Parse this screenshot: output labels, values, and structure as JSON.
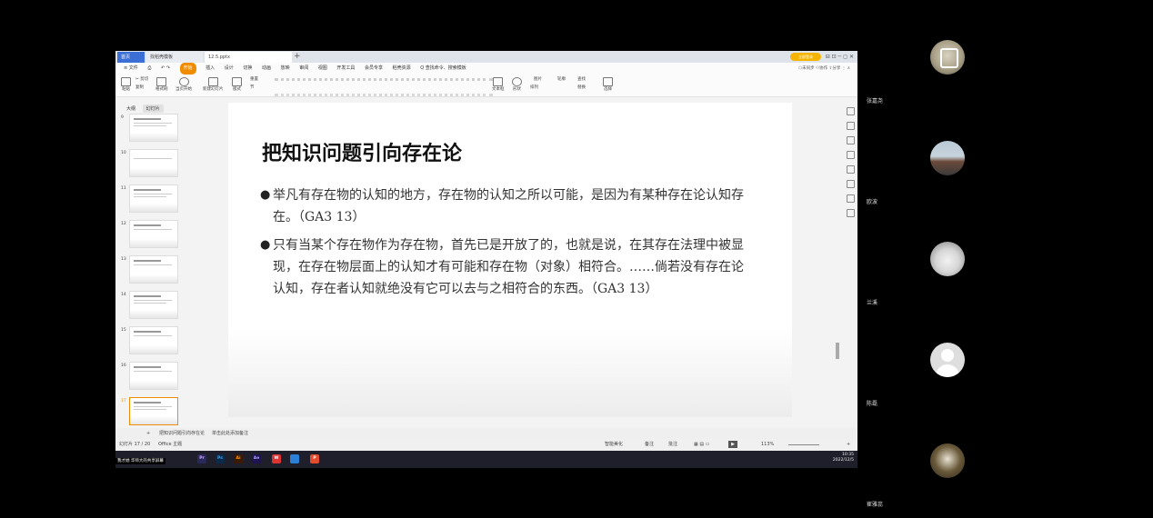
{
  "window": {
    "tabs": [
      "首页",
      "找稻壳模板",
      "12.5.pptx"
    ],
    "login_label": "立即登录",
    "controls": "⊟ ⊡  ─  ◻  ✕"
  },
  "menu": {
    "items": [
      "≡ 文件",
      "⎙",
      "↶ ↷",
      "开始",
      "插入",
      "设计",
      "切换",
      "动画",
      "放映",
      "审阅",
      "视图",
      "开发工具",
      "会员专享",
      "稻壳资源",
      "Q 查找命令、搜索模板"
    ],
    "active": "开始",
    "right": "⬡未同步  ⚇协作  ⇪分享  ⋮  ∧"
  },
  "ribbon": {
    "buttons": [
      "粘贴",
      "✂ 剪切",
      "复制",
      "格式刷",
      "当页开始",
      "新建幻灯片",
      "版式",
      "重置",
      "节",
      "文本框",
      "形状",
      "排列",
      "图片",
      "轮廓",
      "查找",
      "替换",
      "选择"
    ]
  },
  "sidebar": {
    "tabs": [
      "大纲",
      "幻灯片"
    ],
    "slides": [
      "9",
      "10",
      "11",
      "12",
      "13",
      "14",
      "15",
      "16",
      "17"
    ]
  },
  "slide": {
    "title": "把知识问题引向存在论",
    "bullets": [
      "举凡有存在物的认知的地方，存在物的认知之所以可能，是因为有某种存在论认知存在。（GA3 13）",
      "只有当某个存在物作为存在物，首先已是开放了的，也就是说，在其存在法理中被显现，在存在物层面上的认知才有可能和存在物（对象）相符合。……倘若没有存在论认知，存在者认知就绝没有它可以去与之相符合的东西。（GA3 13）"
    ]
  },
  "notes": {
    "add_slide": "+",
    "notes_placeholder": "单击此处添加备注",
    "slide_label": "把知识问题引向存在论"
  },
  "status": {
    "slide_counter": "幻灯片 17 / 20",
    "theme": "Office 主题",
    "smart_beautify": "智能美化",
    "notes_toggle": "备注",
    "comments": "批注",
    "zoom": "113%"
  },
  "taskbar": {
    "apps": [
      "Pr",
      "Ps",
      "Ai",
      "Ae",
      "W",
      "P"
    ],
    "time": "10:35",
    "date": "2022/12/5",
    "share_banner": "我才她 华师大的共享屏幕"
  },
  "participants": [
    {
      "name": "张嘉尧"
    },
    {
      "name": "欧波"
    },
    {
      "name": "兰溪"
    },
    {
      "name": "陈磊"
    },
    {
      "name": "崔雅蕊"
    }
  ],
  "colors": {
    "accent": "#f08c00",
    "tab_active": "#3b6fd6",
    "taskbar": "#1f1f2b"
  }
}
